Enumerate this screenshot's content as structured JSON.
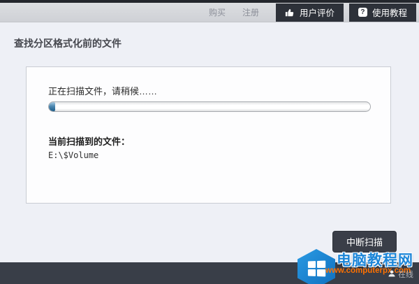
{
  "topbar": {
    "links": [
      {
        "label": "购买"
      },
      {
        "label": "注册"
      }
    ],
    "buttons": [
      {
        "label": "用户评价",
        "icon": "thumbs-up-icon"
      },
      {
        "label": "使用教程",
        "icon": "question-icon",
        "icon_glyph": "?"
      }
    ]
  },
  "page": {
    "title": "查找分区格式化前的文件"
  },
  "scan_panel": {
    "status_message": "正在扫描文件，请稍候……",
    "progress_percent": 2,
    "current_file_label": "当前扫描到的文件：",
    "current_file_path": "E:\\$Volume"
  },
  "actions": {
    "interrupt_label": "中断扫描"
  },
  "watermark": {
    "logo": "windows-hexagon-logo",
    "site_name": "电脑教程网",
    "site_url": "www.computerpx.com",
    "overlay_text": "在线"
  },
  "colors": {
    "topbar_dark_button": "#2d3139",
    "topbar_background": "#d5d7db",
    "page_background": "#eef0f6",
    "panel_background": "#fdfdfe",
    "progress_blue": "#2d6c99",
    "footer_bar": "#393e48",
    "watermark_blue": "#1d86d8",
    "watermark_orange": "#ff7100"
  }
}
